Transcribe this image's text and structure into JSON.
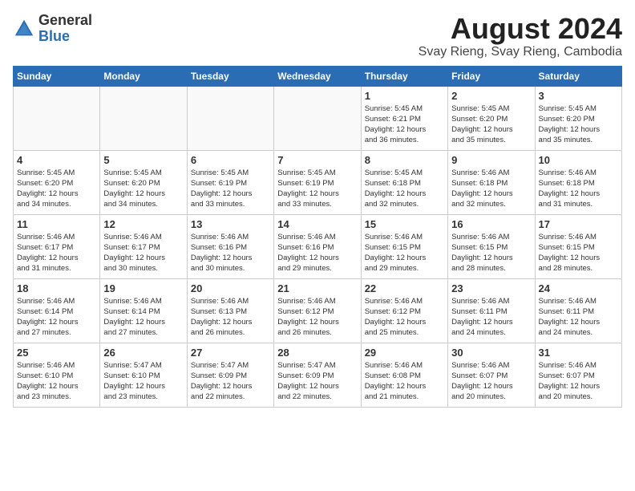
{
  "header": {
    "logo_general": "General",
    "logo_blue": "Blue",
    "month_year": "August 2024",
    "location": "Svay Rieng, Svay Rieng, Cambodia"
  },
  "weekdays": [
    "Sunday",
    "Monday",
    "Tuesday",
    "Wednesday",
    "Thursday",
    "Friday",
    "Saturday"
  ],
  "weeks": [
    [
      {
        "day": "",
        "info": ""
      },
      {
        "day": "",
        "info": ""
      },
      {
        "day": "",
        "info": ""
      },
      {
        "day": "",
        "info": ""
      },
      {
        "day": "1",
        "info": "Sunrise: 5:45 AM\nSunset: 6:21 PM\nDaylight: 12 hours\nand 36 minutes."
      },
      {
        "day": "2",
        "info": "Sunrise: 5:45 AM\nSunset: 6:20 PM\nDaylight: 12 hours\nand 35 minutes."
      },
      {
        "day": "3",
        "info": "Sunrise: 5:45 AM\nSunset: 6:20 PM\nDaylight: 12 hours\nand 35 minutes."
      }
    ],
    [
      {
        "day": "4",
        "info": "Sunrise: 5:45 AM\nSunset: 6:20 PM\nDaylight: 12 hours\nand 34 minutes."
      },
      {
        "day": "5",
        "info": "Sunrise: 5:45 AM\nSunset: 6:20 PM\nDaylight: 12 hours\nand 34 minutes."
      },
      {
        "day": "6",
        "info": "Sunrise: 5:45 AM\nSunset: 6:19 PM\nDaylight: 12 hours\nand 33 minutes."
      },
      {
        "day": "7",
        "info": "Sunrise: 5:45 AM\nSunset: 6:19 PM\nDaylight: 12 hours\nand 33 minutes."
      },
      {
        "day": "8",
        "info": "Sunrise: 5:45 AM\nSunset: 6:18 PM\nDaylight: 12 hours\nand 32 minutes."
      },
      {
        "day": "9",
        "info": "Sunrise: 5:46 AM\nSunset: 6:18 PM\nDaylight: 12 hours\nand 32 minutes."
      },
      {
        "day": "10",
        "info": "Sunrise: 5:46 AM\nSunset: 6:18 PM\nDaylight: 12 hours\nand 31 minutes."
      }
    ],
    [
      {
        "day": "11",
        "info": "Sunrise: 5:46 AM\nSunset: 6:17 PM\nDaylight: 12 hours\nand 31 minutes."
      },
      {
        "day": "12",
        "info": "Sunrise: 5:46 AM\nSunset: 6:17 PM\nDaylight: 12 hours\nand 30 minutes."
      },
      {
        "day": "13",
        "info": "Sunrise: 5:46 AM\nSunset: 6:16 PM\nDaylight: 12 hours\nand 30 minutes."
      },
      {
        "day": "14",
        "info": "Sunrise: 5:46 AM\nSunset: 6:16 PM\nDaylight: 12 hours\nand 29 minutes."
      },
      {
        "day": "15",
        "info": "Sunrise: 5:46 AM\nSunset: 6:15 PM\nDaylight: 12 hours\nand 29 minutes."
      },
      {
        "day": "16",
        "info": "Sunrise: 5:46 AM\nSunset: 6:15 PM\nDaylight: 12 hours\nand 28 minutes."
      },
      {
        "day": "17",
        "info": "Sunrise: 5:46 AM\nSunset: 6:15 PM\nDaylight: 12 hours\nand 28 minutes."
      }
    ],
    [
      {
        "day": "18",
        "info": "Sunrise: 5:46 AM\nSunset: 6:14 PM\nDaylight: 12 hours\nand 27 minutes."
      },
      {
        "day": "19",
        "info": "Sunrise: 5:46 AM\nSunset: 6:14 PM\nDaylight: 12 hours\nand 27 minutes."
      },
      {
        "day": "20",
        "info": "Sunrise: 5:46 AM\nSunset: 6:13 PM\nDaylight: 12 hours\nand 26 minutes."
      },
      {
        "day": "21",
        "info": "Sunrise: 5:46 AM\nSunset: 6:12 PM\nDaylight: 12 hours\nand 26 minutes."
      },
      {
        "day": "22",
        "info": "Sunrise: 5:46 AM\nSunset: 6:12 PM\nDaylight: 12 hours\nand 25 minutes."
      },
      {
        "day": "23",
        "info": "Sunrise: 5:46 AM\nSunset: 6:11 PM\nDaylight: 12 hours\nand 24 minutes."
      },
      {
        "day": "24",
        "info": "Sunrise: 5:46 AM\nSunset: 6:11 PM\nDaylight: 12 hours\nand 24 minutes."
      }
    ],
    [
      {
        "day": "25",
        "info": "Sunrise: 5:46 AM\nSunset: 6:10 PM\nDaylight: 12 hours\nand 23 minutes."
      },
      {
        "day": "26",
        "info": "Sunrise: 5:47 AM\nSunset: 6:10 PM\nDaylight: 12 hours\nand 23 minutes."
      },
      {
        "day": "27",
        "info": "Sunrise: 5:47 AM\nSunset: 6:09 PM\nDaylight: 12 hours\nand 22 minutes."
      },
      {
        "day": "28",
        "info": "Sunrise: 5:47 AM\nSunset: 6:09 PM\nDaylight: 12 hours\nand 22 minutes."
      },
      {
        "day": "29",
        "info": "Sunrise: 5:46 AM\nSunset: 6:08 PM\nDaylight: 12 hours\nand 21 minutes."
      },
      {
        "day": "30",
        "info": "Sunrise: 5:46 AM\nSunset: 6:07 PM\nDaylight: 12 hours\nand 20 minutes."
      },
      {
        "day": "31",
        "info": "Sunrise: 5:46 AM\nSunset: 6:07 PM\nDaylight: 12 hours\nand 20 minutes."
      }
    ]
  ]
}
